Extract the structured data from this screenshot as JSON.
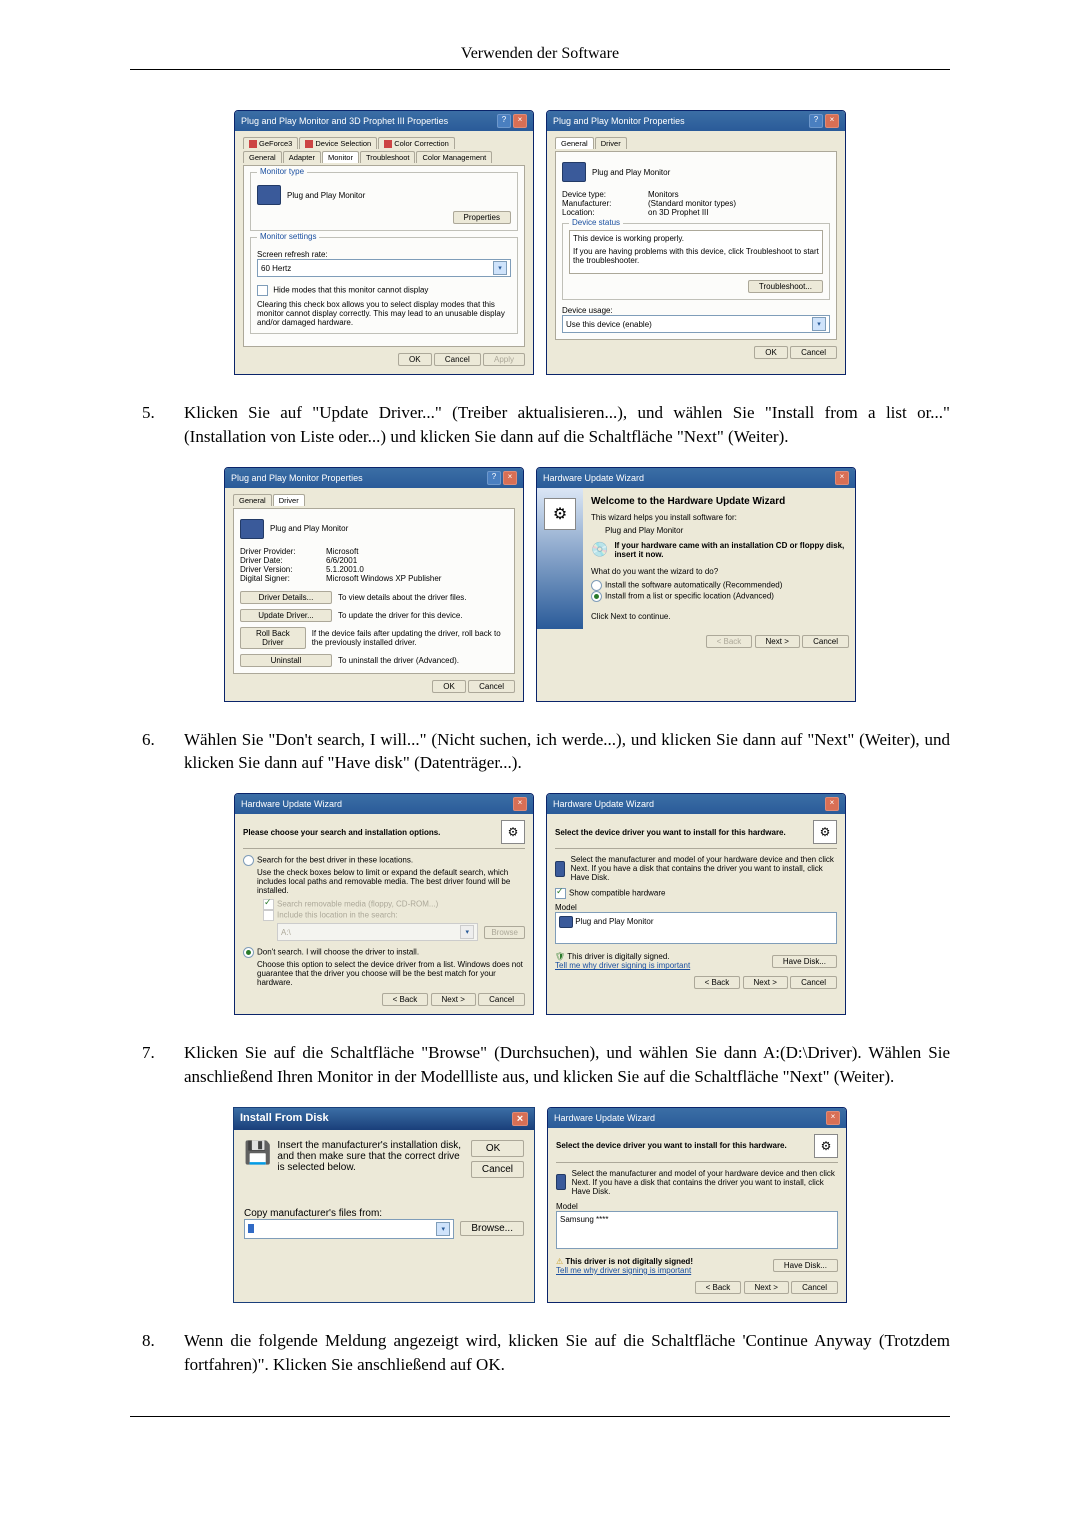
{
  "page_header": "Verwenden der Software",
  "dlg1": {
    "title": "Plug and Play Monitor and 3D Prophet III Properties",
    "tabs_row1": [
      "GeForce3",
      "Device Selection",
      "Color Correction"
    ],
    "tabs_row2": [
      "General",
      "Adapter",
      "Monitor",
      "Troubleshoot",
      "Color Management"
    ],
    "group_type": "Monitor type",
    "monitor_name": "Plug and Play Monitor",
    "properties_btn": "Properties",
    "group_settings": "Monitor settings",
    "refresh_label": "Screen refresh rate:",
    "refresh_value": "60 Hertz",
    "hide_modes": "Hide modes that this monitor cannot display",
    "hide_desc": "Clearing this check box allows you to select display modes that this monitor cannot display correctly. This may lead to an unusable display and/or damaged hardware.",
    "ok": "OK",
    "cancel": "Cancel",
    "apply": "Apply"
  },
  "dlg2": {
    "title": "Plug and Play Monitor Properties",
    "tabs": [
      "General",
      "Driver"
    ],
    "name": "Plug and Play Monitor",
    "device_type_l": "Device type:",
    "device_type_v": "Monitors",
    "manufacturer_l": "Manufacturer:",
    "manufacturer_v": "(Standard monitor types)",
    "location_l": "Location:",
    "location_v": "on 3D Prophet III",
    "status_legend": "Device status",
    "status_text": "This device is working properly.",
    "status_text2": "If you are having problems with this device, click Troubleshoot to start the troubleshooter.",
    "troubleshoot": "Troubleshoot...",
    "usage_l": "Device usage:",
    "usage_v": "Use this device (enable)",
    "ok": "OK",
    "cancel": "Cancel"
  },
  "step5": "Klicken Sie auf \"Update Driver...\" (Treiber aktualisieren...), und wählen Sie \"Install from a list or...\" (Installation von Liste oder...) und klicken Sie dann auf die Schaltfläche \"Next\" (Weiter).",
  "dlg3": {
    "title": "Plug and Play Monitor Properties",
    "tabs": [
      "General",
      "Driver"
    ],
    "name": "Plug and Play Monitor",
    "provider_l": "Driver Provider:",
    "provider_v": "Microsoft",
    "date_l": "Driver Date:",
    "date_v": "6/6/2001",
    "version_l": "Driver Version:",
    "version_v": "5.1.2001.0",
    "signer_l": "Digital Signer:",
    "signer_v": "Microsoft Windows XP Publisher",
    "details_btn": "Driver Details...",
    "details_txt": "To view details about the driver files.",
    "update_btn": "Update Driver...",
    "update_txt": "To update the driver for this device.",
    "rollback_btn": "Roll Back Driver",
    "rollback_txt": "If the device fails after updating the driver, roll back to the previously installed driver.",
    "uninstall_btn": "Uninstall",
    "uninstall_txt": "To uninstall the driver (Advanced).",
    "ok": "OK",
    "cancel": "Cancel"
  },
  "dlg4": {
    "title": "Hardware Update Wizard",
    "heading": "Welcome to the Hardware Update Wizard",
    "help1": "This wizard helps you install software for:",
    "device": "Plug and Play Monitor",
    "cd_hint": "If your hardware came with an installation CD or floppy disk, insert it now.",
    "question": "What do you want the wizard to do?",
    "opt1": "Install the software automatically (Recommended)",
    "opt2": "Install from a list or specific location (Advanced)",
    "continue": "Click Next to continue.",
    "back": "< Back",
    "next": "Next >",
    "cancel": "Cancel"
  },
  "step6": "Wählen Sie \"Don't search, I will...\" (Nicht suchen, ich werde...), und klicken Sie dann auf \"Next\" (Weiter), und klicken Sie dann auf \"Have disk\" (Datenträger...).",
  "dlg5": {
    "title": "Hardware Update Wizard",
    "heading": "Please choose your search and installation options.",
    "opt1": "Search for the best driver in these locations.",
    "opt1_desc": "Use the check boxes below to limit or expand the default search, which includes local paths and removable media. The best driver found will be installed.",
    "cb1": "Search removable media (floppy, CD-ROM...)",
    "cb2": "Include this location in the search:",
    "path": "A:\\",
    "browse": "Browse",
    "opt2": "Don't search. I will choose the driver to install.",
    "opt2_desc": "Choose this option to select the device driver from a list. Windows does not guarantee that the driver you choose will be the best match for your hardware.",
    "back": "< Back",
    "next": "Next >",
    "cancel": "Cancel"
  },
  "dlg6": {
    "title": "Hardware Update Wizard",
    "heading": "Select the device driver you want to install for this hardware.",
    "desc": "Select the manufacturer and model of your hardware device and then click Next. If you have a disk that contains the driver you want to install, click Have Disk.",
    "show_compat": "Show compatible hardware",
    "model_l": "Model",
    "model_item": "Plug and Play Monitor",
    "signed": "This driver is digitally signed.",
    "tell": "Tell me why driver signing is important",
    "have_disk": "Have Disk...",
    "back": "< Back",
    "next": "Next >",
    "cancel": "Cancel"
  },
  "step7": "Klicken Sie auf die Schaltfläche \"Browse\" (Durchsuchen), und wählen Sie dann A:(D:\\Driver). Wählen Sie anschließend Ihren Monitor in der Modellliste aus, und klicken Sie auf die Schaltfläche \"Next\" (Weiter).",
  "dlg7": {
    "title": "Install From Disk",
    "text": "Insert the manufacturer's installation disk, and then make sure that the correct drive is selected below.",
    "ok": "OK",
    "cancel": "Cancel",
    "copy_l": "Copy manufacturer's files from:",
    "browse": "Browse..."
  },
  "dlg8": {
    "title": "Hardware Update Wizard",
    "heading": "Select the device driver you want to install for this hardware.",
    "desc": "Select the manufacturer and model of your hardware device and then click Next. If you have a disk that contains the driver you want to install, click Have Disk.",
    "model_l": "Model",
    "model_item": "Samsung ****",
    "unsigned": "This driver is not digitally signed!",
    "tell": "Tell me why driver signing is important",
    "have_disk": "Have Disk...",
    "back": "< Back",
    "next": "Next >",
    "cancel": "Cancel"
  },
  "step8": "Wenn die folgende Meldung angezeigt wird, klicken Sie auf die Schaltfläche 'Continue Anyway (Trotzdem fortfahren)\". Klicken Sie anschließend auf OK."
}
